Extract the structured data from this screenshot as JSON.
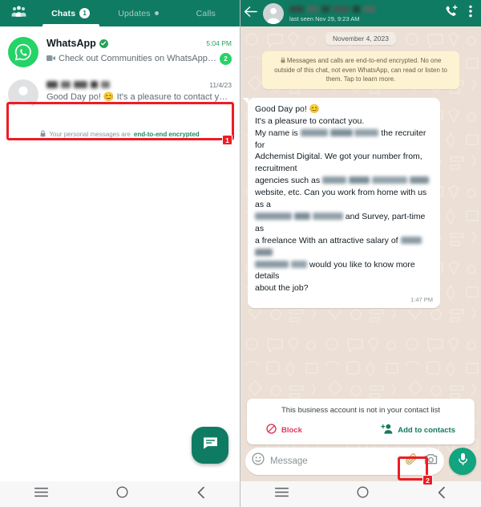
{
  "colors": {
    "brand_green": "#0f7b63",
    "accent_green": "#25d366",
    "annotation_red": "#ee1c24",
    "block_red": "#e0385c",
    "chat_bg": "#ece0d6"
  },
  "left_panel": {
    "communities_icon": "communities-icon",
    "tabs": [
      {
        "label": "Chats",
        "badge": "1",
        "active": true
      },
      {
        "label": "Updates",
        "dot": true,
        "active": false
      },
      {
        "label": "Calls",
        "active": false
      }
    ],
    "chats": [
      {
        "name": "WhatsApp",
        "verified": true,
        "time": "5:04 PM",
        "snippet": "Check out Communities on WhatsApp Bring peop...",
        "has_video_icon": true,
        "unread": "2",
        "avatar": "whatsapp-logo-avatar"
      },
      {
        "name": "",
        "name_redacted": true,
        "time": "11/4/23",
        "snippet": "Good Day po! 😊 It's a pleasure to contact you. My name i...",
        "avatar": "default-person-avatar",
        "highlighted": true
      }
    ],
    "encrypted_note": {
      "lock_icon": "lock-icon",
      "prefix": "Your personal messages are ",
      "emphasis": "end-to-end encrypted"
    },
    "fab": {
      "icon": "new-chat-icon",
      "label": "New chat"
    }
  },
  "right_panel": {
    "header": {
      "back_icon": "back-arrow-icon",
      "avatar": "default-person-avatar",
      "contact_name": "",
      "contact_name_redacted": true,
      "status": "last seen Nov 29, 9:23 AM",
      "call_icon": "add-call-icon",
      "menu_icon": "overflow-menu-icon"
    },
    "date_chip": "November 4, 2023",
    "encryption_banner": {
      "lock_icon": "lock-icon",
      "text": "Messages and calls are end-to-end encrypted. No one outside of this chat, not even WhatsApp, can read or listen to them. Tap to learn more."
    },
    "message": {
      "line_1": "Good Day po! 😊",
      "line_2": "It's a pleasure to contact you.",
      "line_3a": "My name is ",
      "line_3b": " the recruiter for",
      "line_4": "Adchemist Digital. We got your number from, recruitment",
      "line_5a": "agencies such as ",
      "line_6a": "website, etc. Can you work from home with us as a",
      "line_7a": " and Survey, part-time as",
      "line_8a": "a freelance With an attractive salary of ",
      "line_9a": " would you like to know more details",
      "line_10": "about the job?",
      "time": "1:47 PM"
    },
    "business_card": {
      "title": "This business account is not in your contact list",
      "block_label": "Block",
      "block_icon": "block-circle-slash-icon",
      "add_label": "Add to contacts",
      "add_icon": "add-person-icon"
    },
    "composer": {
      "emoji_icon": "emoji-smiley-icon",
      "placeholder": "Message",
      "attach_icon": "paperclip-icon",
      "camera_icon": "camera-icon",
      "mic_icon": "microphone-icon"
    }
  },
  "navbar": {
    "recents_icon": "recents-icon",
    "home_icon": "home-circle-icon",
    "back_icon": "back-chevron-icon"
  },
  "annotations": [
    {
      "number": "1",
      "target": "conversation-list-item"
    },
    {
      "number": "2",
      "target": "attach-button"
    }
  ]
}
